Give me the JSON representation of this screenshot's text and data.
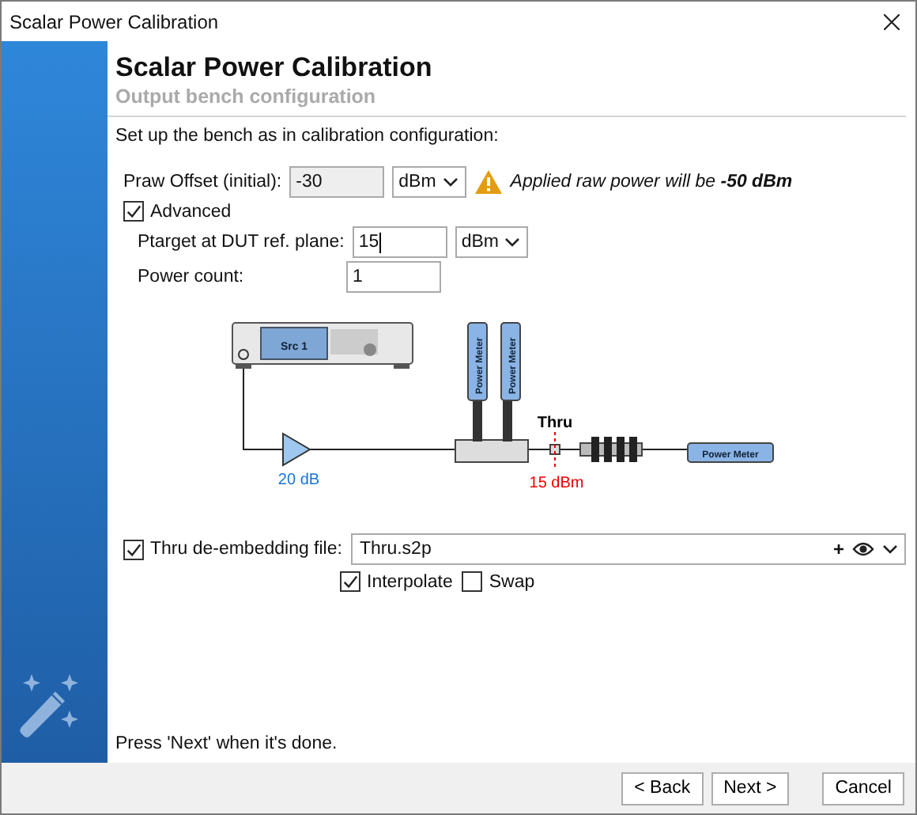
{
  "window": {
    "title": "Scalar Power Calibration"
  },
  "header": {
    "title": "Scalar Power Calibration",
    "subtitle": "Output bench configuration"
  },
  "instruction": "Set up the bench as in calibration configuration:",
  "praw": {
    "label": "Praw Offset (initial):",
    "value": "-30",
    "disabled": true,
    "unit": "dBm",
    "warning": "Applied raw power will be **-50 dBm**"
  },
  "advanced": {
    "label": "Advanced",
    "checked": true
  },
  "ptarget": {
    "label": "Ptarget at DUT ref. plane:",
    "value": "15",
    "unit": "dBm"
  },
  "power_count": {
    "label": "Power count:",
    "value": "1"
  },
  "diagram": {
    "source": "Src 1",
    "meters": [
      "Power Meter",
      "Power Meter"
    ],
    "thru": "Thru",
    "gain": "20 dB",
    "target": "15 dBm",
    "output_meter": "Power Meter"
  },
  "thru_file": {
    "label": "Thru de-embedding file:",
    "checked": true,
    "value": "Thru.s2p",
    "add": "+"
  },
  "options": [
    {
      "label": "Interpolate",
      "checked": true
    },
    {
      "label": "Swap",
      "checked": false
    }
  ],
  "footer_note": "Press 'Next' when it's done.",
  "buttons": [
    "< Back",
    "Next >",
    "Cancel"
  ]
}
